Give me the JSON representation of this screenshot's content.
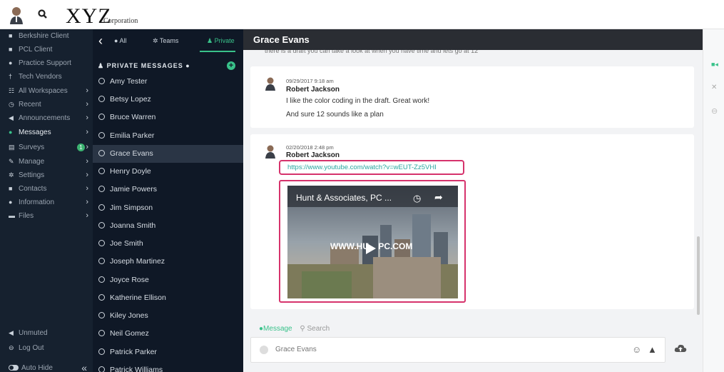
{
  "header": {
    "logo": "XYZ",
    "logo_sub": "Corporation"
  },
  "nav": {
    "items": [
      {
        "icon": "briefcase-icon",
        "label": "Berkshire Client"
      },
      {
        "icon": "briefcase-icon",
        "label": "PCL Client"
      },
      {
        "icon": "support-icon",
        "label": "Practice Support"
      },
      {
        "icon": "person-icon",
        "label": "Tech Vendors"
      },
      {
        "icon": "grid-icon",
        "label": "All Workspaces"
      },
      {
        "icon": "clock-icon",
        "label": "Recent"
      },
      {
        "icon": "megaphone-icon",
        "label": "Announcements"
      },
      {
        "icon": "chat-icon",
        "label": "Messages"
      },
      {
        "icon": "clipboard-icon",
        "label": "Surveys"
      },
      {
        "icon": "pencil-icon",
        "label": "Manage"
      },
      {
        "icon": "gear-icon",
        "label": "Settings"
      },
      {
        "icon": "contacts-icon",
        "label": "Contacts"
      },
      {
        "icon": "info-icon",
        "label": "Information"
      },
      {
        "icon": "folder-icon",
        "label": "Files"
      }
    ],
    "surveys_badge": "1",
    "unmuted": "Unmuted",
    "logout": "Log Out",
    "autohide": "Auto Hide",
    "collapse": "«"
  },
  "contacts": {
    "tabs": {
      "all": "All",
      "teams": "Teams",
      "private": "Private"
    },
    "header": "PRIVATE MESSAGES",
    "list": [
      "Amy Tester",
      "Betsy Lopez",
      "Bruce Warren",
      "Emilia Parker",
      "Grace Evans",
      "Henry Doyle",
      "Jamie Powers",
      "Jim Simpson",
      "Joanna Smith",
      "Joe Smith",
      "Joseph Martinez",
      "Joyce Rose",
      "Katherine Ellison",
      "Kiley Jones",
      "Neil Gomez",
      "Patrick Parker",
      "Patrick Williams"
    ],
    "selected": "Grace Evans"
  },
  "chat": {
    "title": "Grace Evans",
    "partial_line": "there is a draft you can take a look at when you have time and lets go at 12",
    "messages": [
      {
        "time": "09/29/2017 9:18 am",
        "author": "Robert Jackson",
        "lines": [
          "I like the color coding in the draft. Great work!",
          "And sure 12 sounds like a plan"
        ]
      },
      {
        "time": "02/20/2018 2:48 pm",
        "author": "Robert Jackson",
        "link": "https://www.youtube.com/watch?v=wEUT-Zz5VHI",
        "video_title": "Hunt & Associates, PC ...",
        "video_watermark": "WWW.HU    PC.COM"
      }
    ],
    "composer": {
      "tab_message": "Message",
      "tab_search": "Search",
      "placeholder": "Grace Evans"
    }
  },
  "colors": {
    "accent": "#39c28a",
    "highlight": "#d6336c",
    "link": "#2aa7a0",
    "nav_bg": "#16212f"
  }
}
